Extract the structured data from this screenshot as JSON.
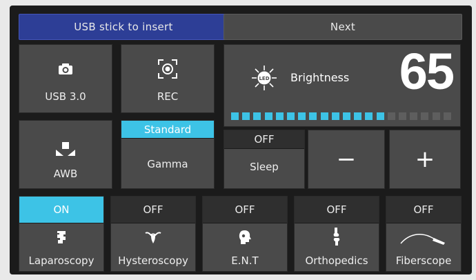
{
  "top_bar": {
    "usb_button_label": "USB stick to insert",
    "next_button_label": "Next"
  },
  "tiles": {
    "usb": {
      "label": "USB 3.0",
      "icon": "camera-icon"
    },
    "rec": {
      "label": "REC",
      "icon": "record-icon"
    },
    "awb": {
      "label": "AWB",
      "icon": "white-balance-icon"
    },
    "gamma": {
      "label": "Gamma",
      "mode": "Standard"
    }
  },
  "brightness": {
    "label": "Brightness",
    "value": "65",
    "icon": "led-icon",
    "level_segments_total": 20,
    "level_segments_active": 14
  },
  "sleep": {
    "label": "Sleep",
    "state": "OFF"
  },
  "controls": {
    "minus": "−",
    "plus": "+"
  },
  "modes": [
    {
      "label": "Laparoscopy",
      "state": "ON",
      "icon": "organ-icon"
    },
    {
      "label": "Hysteroscopy",
      "state": "OFF",
      "icon": "uterus-icon"
    },
    {
      "label": "E.N.T",
      "state": "OFF",
      "icon": "head-icon"
    },
    {
      "label": "Orthopedics",
      "state": "OFF",
      "icon": "joint-icon"
    },
    {
      "label": "Fiberscope",
      "state": "OFF",
      "icon": "fiberscope-icon"
    }
  ],
  "colors": {
    "accent": "#3dc3e6",
    "usb_banner": "#2d3e96",
    "tile": "#4a4a4a",
    "state_off": "#2f2f2f",
    "segment_off": "#5e5e5e"
  }
}
